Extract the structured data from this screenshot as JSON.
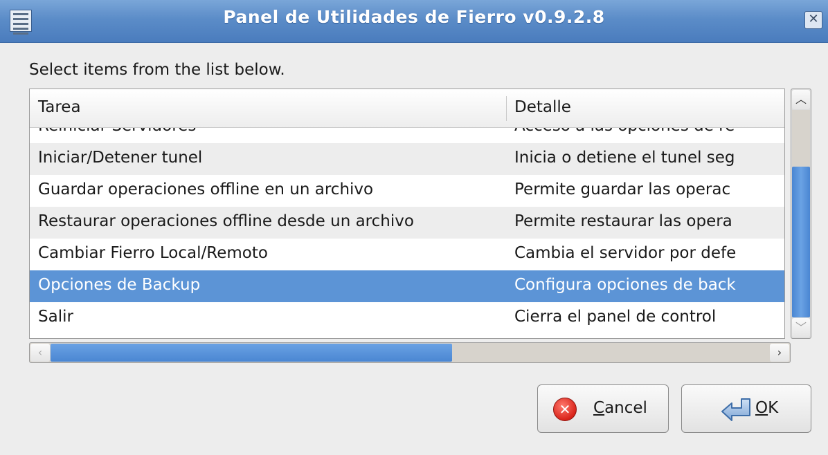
{
  "window": {
    "title": "Panel de Utilidades de Fierro v0.9.2.8",
    "icons": {
      "menu": "window-menu-icon",
      "close": "close-icon"
    }
  },
  "prompt": "Select items from the list below.",
  "table": {
    "columns": [
      "Tarea",
      "Detalle"
    ],
    "rows": [
      {
        "tarea": "Reiniciar Servidores",
        "detalle": "Acceso a las opciones de re"
      },
      {
        "tarea": "Iniciar/Detener tunel",
        "detalle": "Inicia o detiene el tunel seg"
      },
      {
        "tarea": "Guardar operaciones offline en un archivo",
        "detalle": "Permite guardar las operac"
      },
      {
        "tarea": "Restaurar operaciones offline desde un archivo",
        "detalle": "Permite restaurar las opera"
      },
      {
        "tarea": "Cambiar Fierro Local/Remoto",
        "detalle": "Cambia el servidor por defe"
      },
      {
        "tarea": "Opciones de Backup",
        "detalle": "Configura opciones de back"
      },
      {
        "tarea": "Salir",
        "detalle": "Cierra el panel de control"
      }
    ],
    "selected_index": 5
  },
  "buttons": {
    "cancel": {
      "mnemonic": "C",
      "rest": "ancel",
      "icon": "cancel-icon"
    },
    "ok": {
      "mnemonic": "O",
      "rest": "K",
      "icon": "ok-arrow-icon"
    }
  },
  "colors": {
    "titlebar": "#5b8cc8",
    "selection": "#5c94d6"
  }
}
